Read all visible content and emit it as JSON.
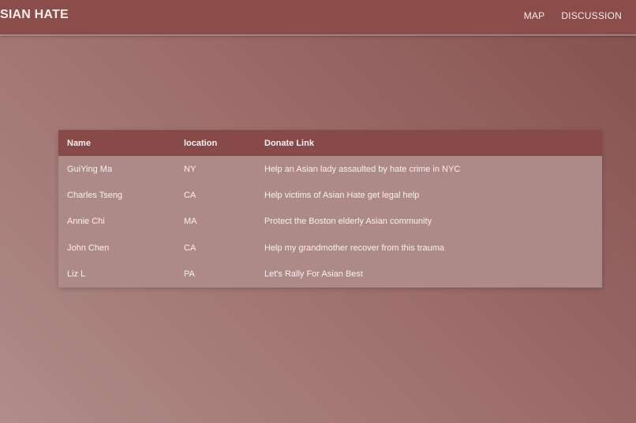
{
  "brand": {
    "title": "SIAN HATE"
  },
  "nav": {
    "items": [
      {
        "label": "MAP"
      },
      {
        "label": "DISCUSSION"
      }
    ]
  },
  "table": {
    "headers": [
      "Name",
      "location",
      "Donate Link"
    ],
    "rows": [
      {
        "name": "GuiYing Ma",
        "location": "NY",
        "link": "Help an Asian lady assaulted by hate crime in NYC"
      },
      {
        "name": "Charles Tseng",
        "location": "CA",
        "link": "Help victims of Asian Hate get legal help"
      },
      {
        "name": "Annie Chi",
        "location": "MA",
        "link": "Protect the Boston elderly Asian community"
      },
      {
        "name": "John Chen",
        "location": "CA",
        "link": "Help my grandmother recover from this trauma"
      },
      {
        "name": "Liz L",
        "location": "PA",
        "link": "Let's Rally For Asian Best"
      }
    ]
  },
  "colors": {
    "navbar": "#8a4d4a",
    "table_header": "#874a48",
    "table_body": "#ad8a88",
    "text": "#fbf0ef"
  }
}
